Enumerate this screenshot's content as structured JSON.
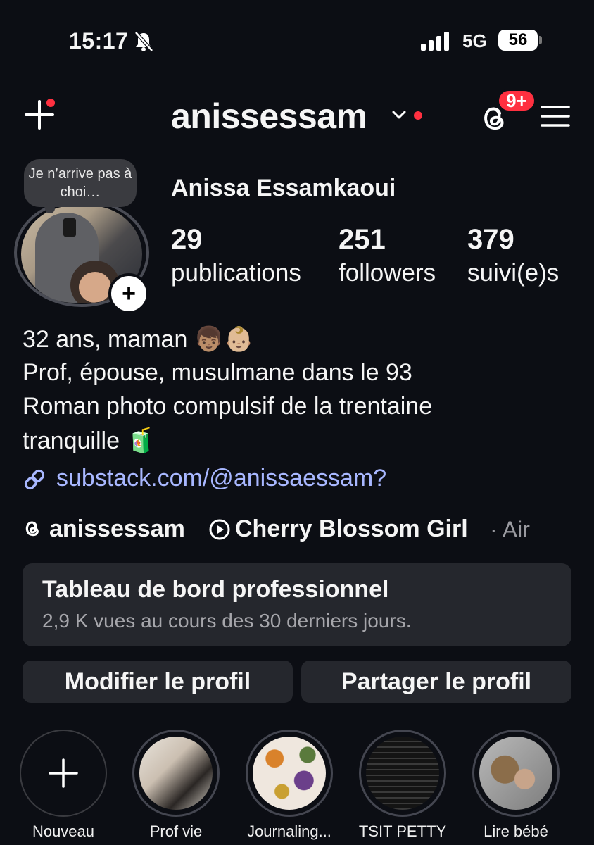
{
  "status_bar": {
    "time": "15:17",
    "network": "5G",
    "battery": "56"
  },
  "header": {
    "username": "anissessam",
    "notification_badge": "9+"
  },
  "profile": {
    "note": "Je n’arrive pas à choi…",
    "full_name": "Anissa Essamkaoui",
    "stats": [
      {
        "value": "29",
        "label": "publications"
      },
      {
        "value": "251",
        "label": "followers"
      },
      {
        "value": "379",
        "label": "suivi(e)s"
      }
    ],
    "bio_lines": [
      "32 ans, maman 👦🏽👶🏼",
      "Prof, épouse, musulmane dans le 93",
      "Roman photo compulsif de la trentaine",
      "tranquille 🧃"
    ],
    "link": "substack.com/@anissaessam?",
    "threads_handle": "anissessam",
    "song": {
      "title": "Cherry Blossom Girl",
      "artist": "· Air"
    }
  },
  "dashboard": {
    "title": "Tableau de bord professionnel",
    "subtitle": "2,9 K vues au cours des 30 derniers jours."
  },
  "buttons": {
    "edit": "Modifier le profil",
    "share": "Partager le profil"
  },
  "highlights": [
    {
      "label": "Nouveau"
    },
    {
      "label": "Prof vie"
    },
    {
      "label": "Journaling..."
    },
    {
      "label": "TSIT PETTY"
    },
    {
      "label": "Lire bébé"
    }
  ],
  "colors": {
    "background": "#0c0e14",
    "accent_red": "#ff3040",
    "link": "#a8b7ff",
    "card": "#25272d"
  }
}
